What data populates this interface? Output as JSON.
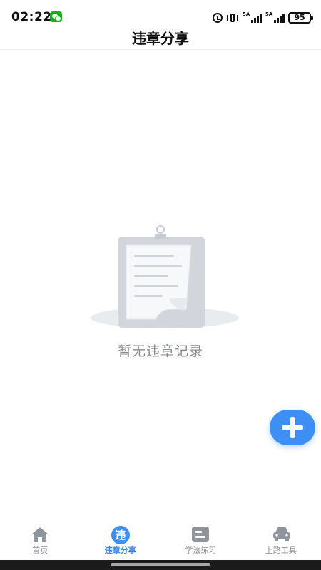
{
  "status": {
    "time": "02:22",
    "net1": "5A",
    "net2": "5A",
    "battery": "95"
  },
  "header": {
    "title": "违章分享"
  },
  "empty_state": {
    "message": "暂无违章记录"
  },
  "fab": {
    "label": "+"
  },
  "bottom_nav": {
    "items": [
      {
        "label": "首页",
        "icon": "home-icon"
      },
      {
        "label": "违章分享",
        "icon": "violation-icon",
        "badge": "违"
      },
      {
        "label": "学法练习",
        "icon": "study-icon"
      },
      {
        "label": "上路工具",
        "icon": "car-icon"
      }
    ],
    "active_index": 1
  },
  "colors": {
    "accent": "#3d8ff5",
    "inactive": "#8a8f96",
    "empty_text": "#888d93"
  }
}
